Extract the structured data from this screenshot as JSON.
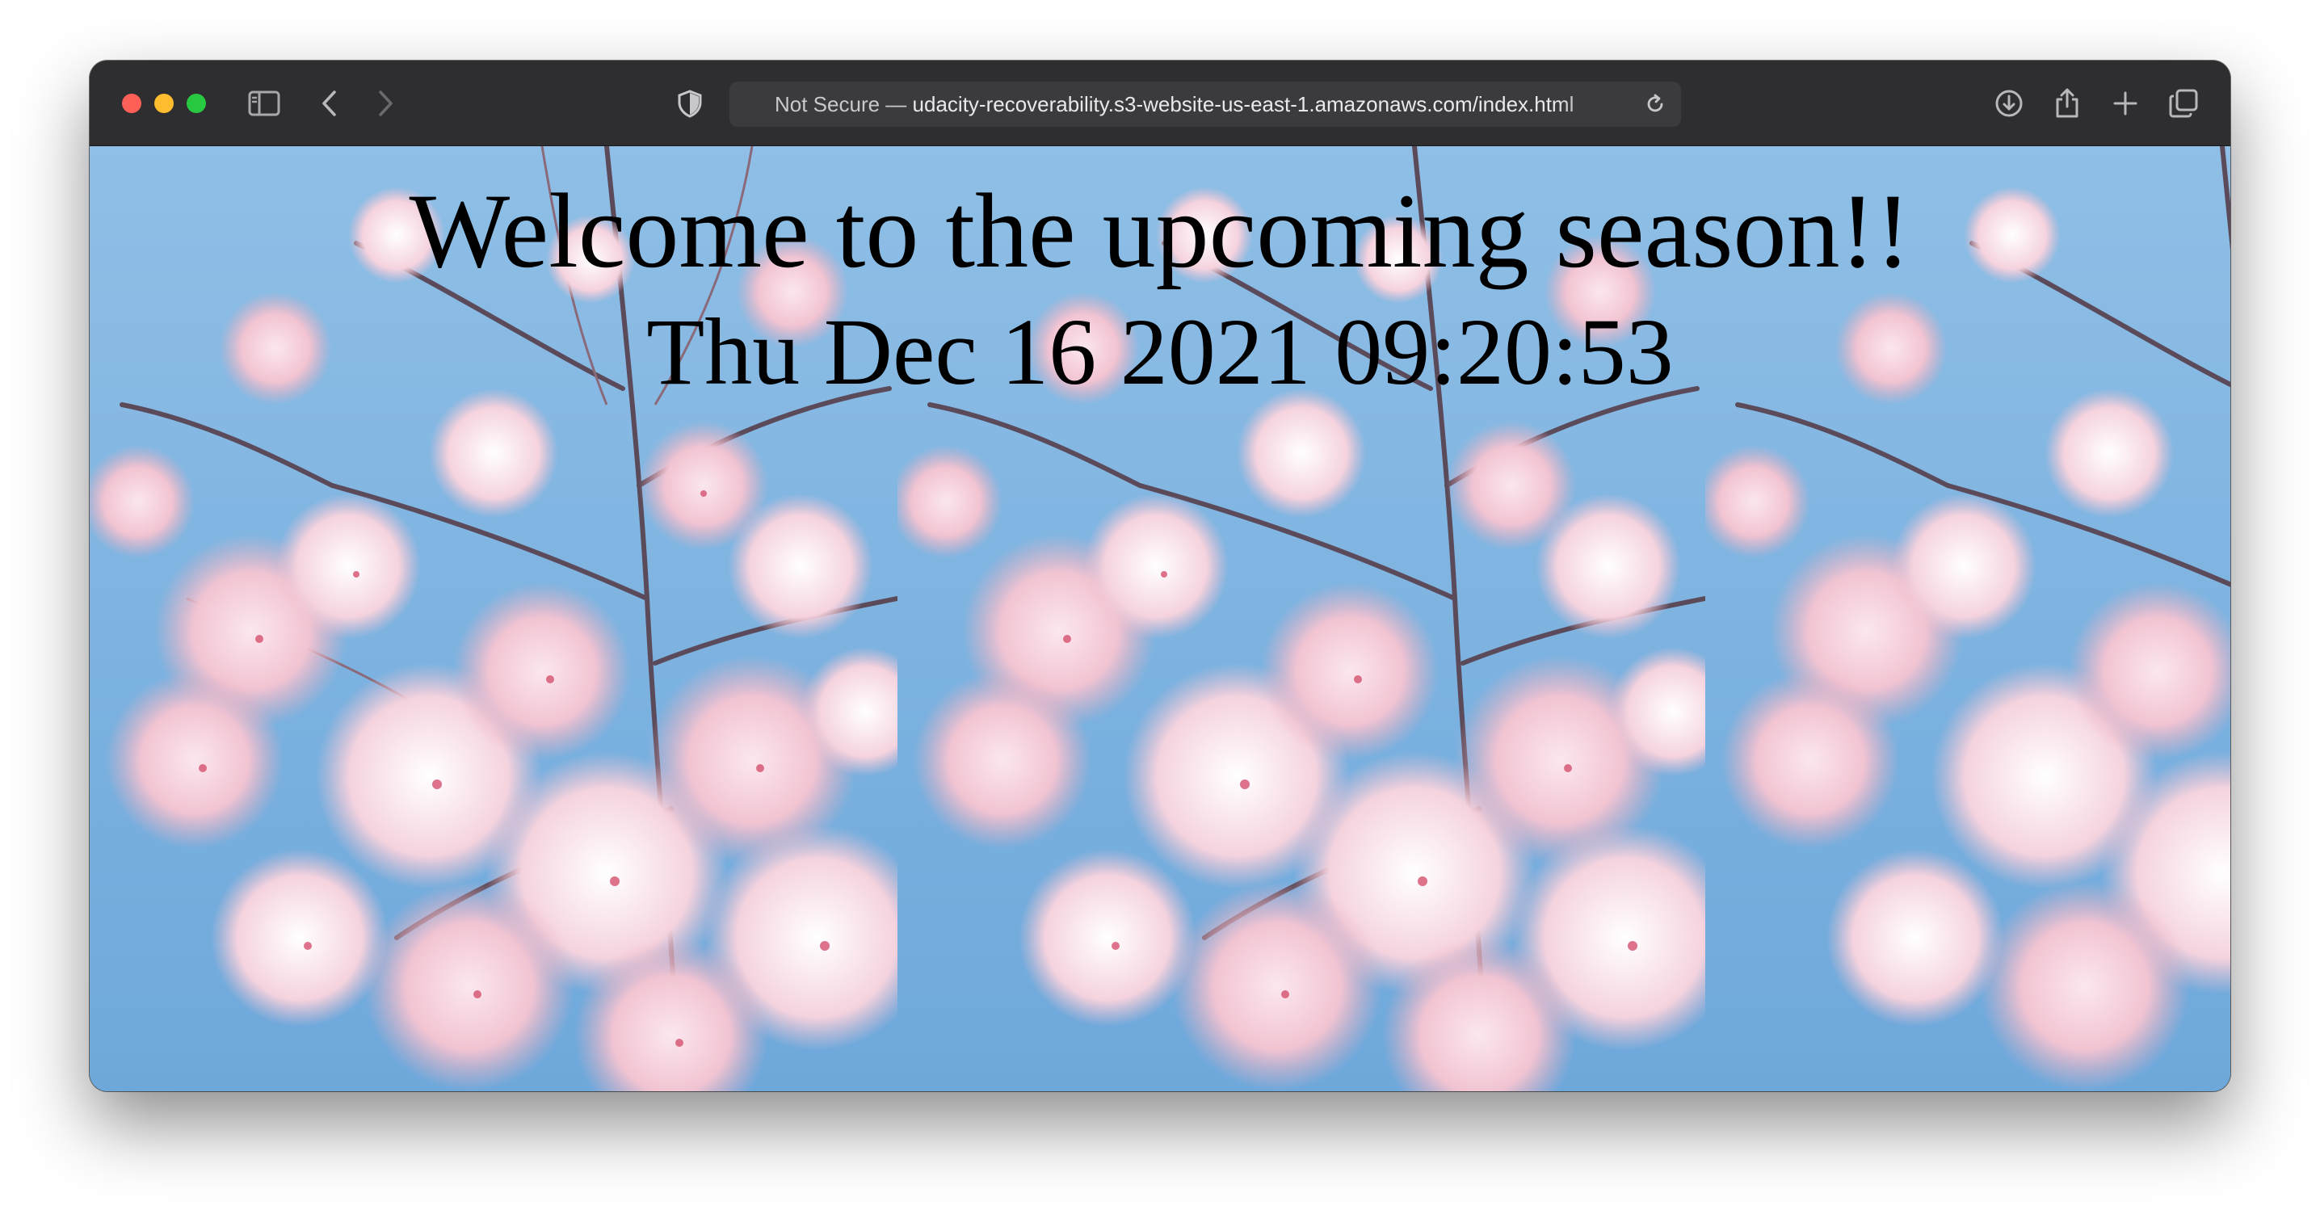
{
  "browser": {
    "address_bar": {
      "security_label": "Not Secure —",
      "url": "udacity-recoverability.s3-website-us-east-1.amazonaws.com/index.html"
    },
    "icons": {
      "sidebar": "sidebar-icon",
      "back": "chevron-left-icon",
      "forward": "chevron-right-icon",
      "privacy": "shield-icon",
      "reload": "reload-icon",
      "downloads": "download-icon",
      "share": "share-icon",
      "new_tab": "plus-icon",
      "tabs": "tab-overview-icon"
    },
    "colors": {
      "close": "#fe5f57",
      "minimize": "#febc2e",
      "zoom": "#28c840"
    }
  },
  "page": {
    "headline": "Welcome to the upcoming season!!",
    "datetime": "Thu Dec 16 2021 09:20:53",
    "background_image": "cherry-blossom-photo"
  }
}
